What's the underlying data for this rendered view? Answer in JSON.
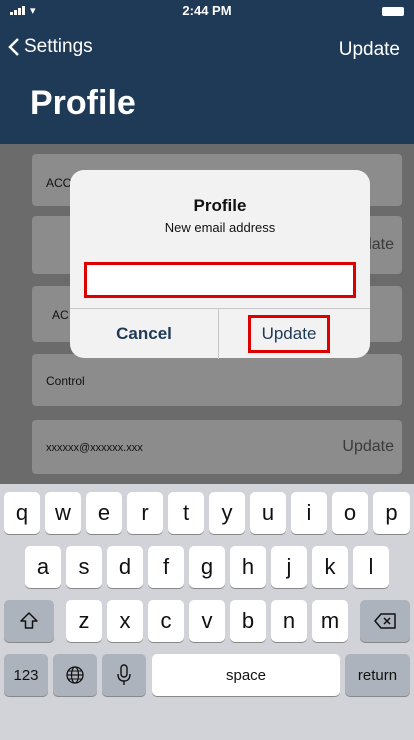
{
  "status_bar": {
    "time": "2:44 PM",
    "icons": [
      "signal-icon",
      "wifi-icon",
      "battery-icon"
    ]
  },
  "nav": {
    "back_label": "Settings",
    "back_icon": "chevron-left-icon",
    "update_label": "Update",
    "title": "Profile"
  },
  "rows": [
    {
      "label": "ACC",
      "action": ""
    },
    {
      "label": "",
      "action": "date"
    },
    {
      "label": "AC",
      "action": ""
    },
    {
      "label": "Control",
      "action": ""
    },
    {
      "label": "xxxxxx@xxxxxx.xxx",
      "action": "Update"
    },
    {
      "label": "",
      "action": ""
    }
  ],
  "dialog": {
    "title": "Profile",
    "message": "New email address",
    "input_value": "",
    "cancel_label": "Cancel",
    "update_label": "Update"
  },
  "keyboard": {
    "row1": [
      "q",
      "w",
      "e",
      "r",
      "t",
      "y",
      "u",
      "i",
      "o",
      "p"
    ],
    "row2": [
      "a",
      "s",
      "d",
      "f",
      "g",
      "h",
      "j",
      "k",
      "l"
    ],
    "row3": [
      "z",
      "x",
      "c",
      "v",
      "b",
      "n",
      "m"
    ],
    "shift_icon": "shift-icon",
    "backspace_icon": "backspace-icon",
    "numbers_label": "123",
    "globe_icon": "globe-icon",
    "mic_icon": "microphone-icon",
    "space_label": "space",
    "return_label": "return"
  },
  "colors": {
    "nav_background": "#1e3a56",
    "highlight": "#dd0000"
  }
}
